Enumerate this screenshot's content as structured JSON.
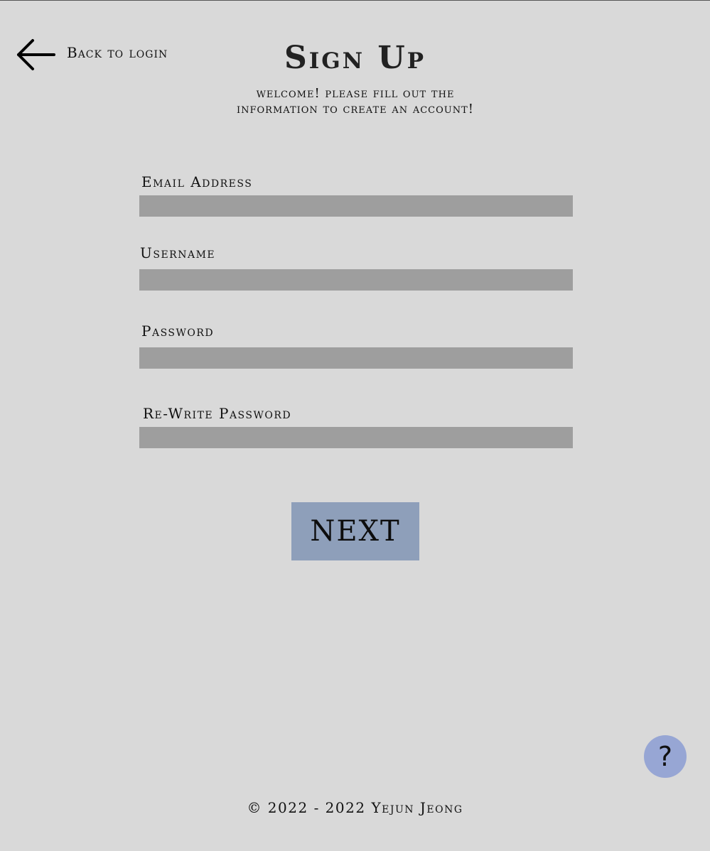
{
  "nav": {
    "back_label": "Back to login"
  },
  "header": {
    "title": "Sign Up",
    "welcome": "welcome! please fill out the information to create an account!"
  },
  "form": {
    "email": {
      "label": "Email Address",
      "value": ""
    },
    "username": {
      "label": "Username",
      "value": ""
    },
    "password": {
      "label": "Password",
      "value": ""
    },
    "rewrite_password": {
      "label": "Re-Write Password",
      "value": ""
    },
    "next_label": "NEXT"
  },
  "help": {
    "label": "?"
  },
  "footer": {
    "text": "© 2022 - 2022 Yejun Jeong"
  },
  "colors": {
    "background": "#d9d9d9",
    "input_fill": "#9e9e9e",
    "next_button": "#8e9fba",
    "help_button": "#97a6d4"
  },
  "icons": {
    "back": "arrow-left-icon"
  }
}
